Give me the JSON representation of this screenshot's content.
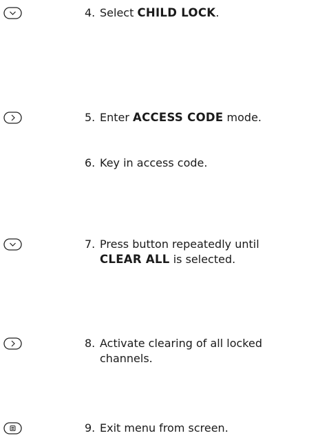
{
  "steps": [
    {
      "icon": "down-button-icon",
      "number": "4.",
      "lines": [
        [
          {
            "t": "Select "
          },
          {
            "t": "CHILD LOCK",
            "b": true
          },
          {
            "t": "."
          }
        ]
      ]
    },
    {
      "icon": "right-button-icon",
      "number": "5.",
      "lines": [
        [
          {
            "t": "Enter "
          },
          {
            "t": "ACCESS CODE",
            "b": true
          },
          {
            "t": " mode."
          }
        ]
      ]
    },
    {
      "icon": null,
      "number": "6.",
      "lines": [
        [
          {
            "t": "Key in access code."
          }
        ]
      ]
    },
    {
      "icon": "down-button-icon",
      "number": "7.",
      "lines": [
        [
          {
            "t": "Press button repeatedly until"
          }
        ],
        [
          {
            "t": "CLEAR ALL",
            "b": true
          },
          {
            "t": " is selected."
          }
        ]
      ]
    },
    {
      "icon": "right-button-icon",
      "number": "8.",
      "lines": [
        [
          {
            "t": "Activate clearing of all locked"
          }
        ],
        [
          {
            "t": "channels."
          }
        ]
      ]
    },
    {
      "icon": "menu-button-icon",
      "number": "9.",
      "lines": [
        [
          {
            "t": "Exit menu from screen."
          }
        ]
      ]
    }
  ]
}
